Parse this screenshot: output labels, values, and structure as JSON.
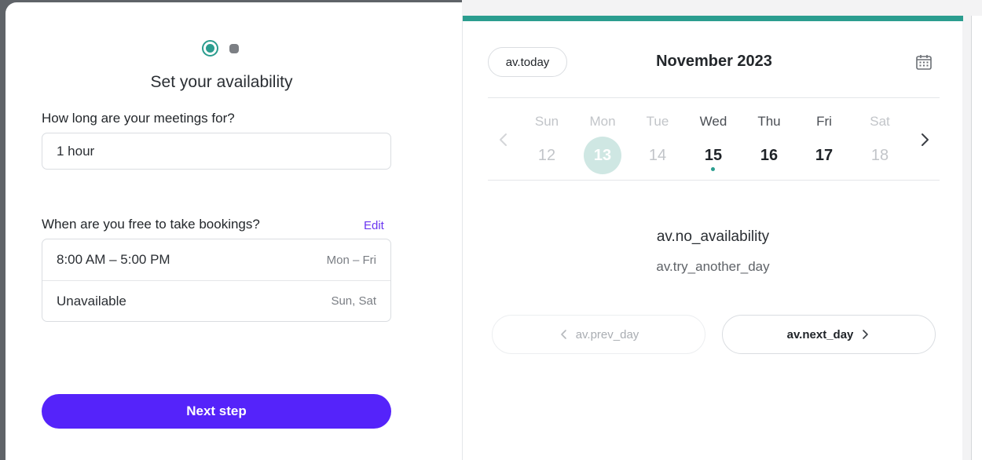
{
  "onboarding": {
    "title": "Set your availability",
    "duration_question": "How long are your meetings for?",
    "duration_value": "1 hour",
    "free_question": "When are you free to take bookings?",
    "edit_label": "Edit",
    "schedule": [
      {
        "time": "8:00 AM – 5:00 PM",
        "days": "Mon – Fri"
      },
      {
        "time": "Unavailable",
        "days": "Sun, Sat"
      }
    ],
    "next_label": "Next step",
    "accent_color": "#5523fa"
  },
  "calendar": {
    "today_label": "av.today",
    "month_label": "November 2023",
    "days": [
      {
        "name": "Sun",
        "num": "12"
      },
      {
        "name": "Mon",
        "num": "13"
      },
      {
        "name": "Tue",
        "num": "14"
      },
      {
        "name": "Wed",
        "num": "15"
      },
      {
        "name": "Thu",
        "num": "16"
      },
      {
        "name": "Fri",
        "num": "17"
      },
      {
        "name": "Sat",
        "num": "18"
      }
    ],
    "no_availability": "av.no_availability",
    "try_another_day": "av.try_another_day",
    "prev_day_label": "av.prev_day",
    "next_day_label": "av.next_day",
    "accent_color": "#2b9d8f"
  }
}
